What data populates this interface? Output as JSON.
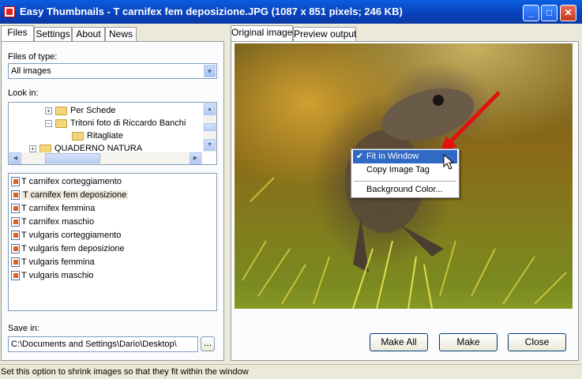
{
  "window": {
    "title": "Easy Thumbnails - T carnifex fem deposizione.JPG  (1087 x 851 pixels;  246 KB)",
    "minimize": "_",
    "maximize": "□",
    "close": "✕"
  },
  "left_tabs": [
    "Files",
    "Settings",
    "About",
    "News"
  ],
  "files_of_type": {
    "label": "Files of type:",
    "value": "All images"
  },
  "look_in": {
    "label": "Look in:",
    "tree": [
      {
        "label": "Per Schede",
        "toggle": "+"
      },
      {
        "label": "Tritoni foto di Riccardo Banchi",
        "toggle": "−"
      },
      {
        "label": "Ritagliate",
        "toggle": ""
      },
      {
        "label": "QUADERNO NATURA",
        "toggle": "+"
      }
    ]
  },
  "files": [
    "T carnifex corteggiamento",
    "T carnifex fem deposizione",
    "T carnifex femmina",
    "T carnifex maschio",
    "T vulgaris corteggiamento",
    "T vulgaris fem deposizione",
    "T vulgaris femmina",
    "T vulgaris maschio"
  ],
  "selected_file_index": 1,
  "save_in": {
    "label": "Save in:",
    "value": "C:\\Documents and Settings\\Dario\\Desktop\\",
    "browse": "..."
  },
  "right_tabs": [
    "Original image",
    "Preview output"
  ],
  "context_menu": {
    "items": [
      "Fit in Window",
      "Copy Image Tag",
      "Background Color..."
    ],
    "checked": "✔"
  },
  "buttons": {
    "make_all": "Make All",
    "make": "Make",
    "close": "Close"
  },
  "status": "Set this option to shrink images so that they fit within the window"
}
